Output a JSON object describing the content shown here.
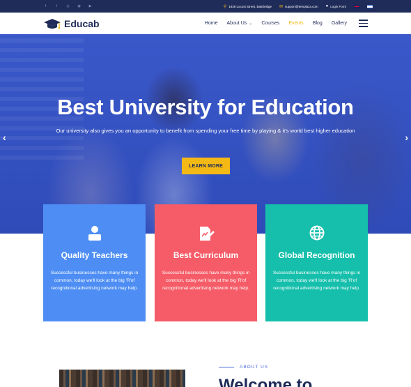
{
  "topbar": {
    "socials": [
      "facebook-icon",
      "twitter-icon",
      "github-icon",
      "dribbble-icon",
      "youtube-icon"
    ],
    "address": "1836 Locust Street, Bainbridge",
    "email": "support@templaza.com",
    "login": "Login Form"
  },
  "brand": {
    "name": "Educab"
  },
  "nav": {
    "items": [
      "Home",
      "About Us",
      "Courses",
      "Events",
      "Blog",
      "Gallery"
    ],
    "active": "Events"
  },
  "hero": {
    "title": "Best University for Education",
    "subtitle": "Our university also gives you an opportunity to benefit from spending your free time by playing & it's world best higher education",
    "button": "LEARN MORE"
  },
  "features": [
    {
      "title": "Quality Teachers",
      "text": "Successful businesses have many things in common, today we'll look at the big 'R'of recognitional advertising network may help.",
      "color": "#4e8ef4"
    },
    {
      "title": "Best Curriculum",
      "text": "Successful businesses have many things in common, today we'll look at the big 'R'of recognitional advertising network may help.",
      "color": "#f55c67"
    },
    {
      "title": "Global Recognition",
      "text": "Successful businesses have many things in common, today we'll look at the big 'R'of recognitional advertising network may help.",
      "color": "#15bfab"
    }
  ],
  "about": {
    "kicker": "ABOUT US",
    "title": "Welcome to"
  },
  "colors": {
    "navy": "#1f2b59",
    "accent": "#f5b916",
    "hero": "#3552c2"
  }
}
